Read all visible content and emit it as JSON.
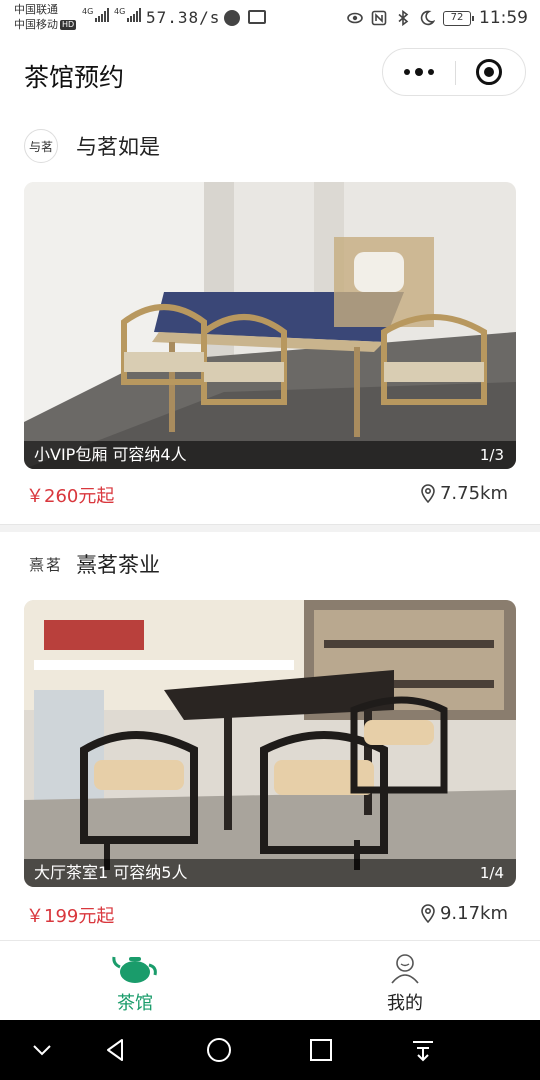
{
  "status_bar": {
    "carrier_1": "中国联通",
    "carrier_2": "中国移动",
    "hd": "HD",
    "net_type_1": "4G",
    "net_type_2": "4G",
    "net_speed": "57.38/s",
    "battery": "72",
    "time": "11:59"
  },
  "header": {
    "title": "茶馆预约",
    "more_icon": "more-dots-icon",
    "close_icon": "capsule-close-icon"
  },
  "shops": [
    {
      "logo_text": "与茗",
      "name": "与茗如是",
      "photo_caption": "小VIP包厢 可容纳4人",
      "photo_index": "1/3",
      "price": "￥260元起",
      "distance": "7.75km"
    },
    {
      "logo_text": "熹茗",
      "name": "熹茗茶业",
      "photo_caption": "大厅茶室1 可容纳5人",
      "photo_index": "1/4",
      "price": "￥199元起",
      "distance": "9.17km"
    }
  ],
  "tabbar": {
    "tabs": [
      {
        "label": "茶馆",
        "icon": "teapot-icon",
        "active": true
      },
      {
        "label": "我的",
        "icon": "user-icon",
        "active": false
      }
    ]
  },
  "colors": {
    "accent_green": "#1a9c6b",
    "price_red": "#d9373d"
  }
}
